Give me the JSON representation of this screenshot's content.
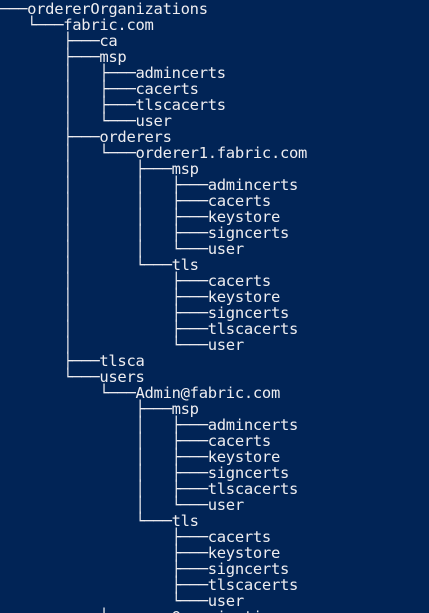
{
  "console": {
    "background": "#012456",
    "foreground": "#eeedf0",
    "lines": [
      "───ordererOrganizations",
      "   └───fabric.com",
      "       ├───ca",
      "       ├───msp",
      "       │   ├───admincerts",
      "       │   ├───cacerts",
      "       │   ├───tlscacerts",
      "       │   └───user",
      "       ├───orderers",
      "       │   └───orderer1.fabric.com",
      "       │       ├───msp",
      "       │       │   ├───admincerts",
      "       │       │   ├───cacerts",
      "       │       │   ├───keystore",
      "       │       │   ├───signcerts",
      "       │       │   └───user",
      "       │       └───tls",
      "       │           ├───cacerts",
      "       │           ├───keystore",
      "       │           ├───signcerts",
      "       │           ├───tlscacerts",
      "       │           └───user",
      "       ├───tlsca",
      "       └───users",
      "           └───Admin@fabric.com",
      "               ├───msp",
      "               │   ├───admincerts",
      "               │   ├───cacerts",
      "               │   ├───keystore",
      "               │   ├───signcerts",
      "               │   ├───tlscacerts",
      "               │   └───user",
      "               └───tls",
      "                   ├───cacerts",
      "                   ├───keystore",
      "                   ├───signcerts",
      "                   ├───tlscacerts",
      "                   └───user",
      "           ├───peerOrganizations"
    ]
  }
}
